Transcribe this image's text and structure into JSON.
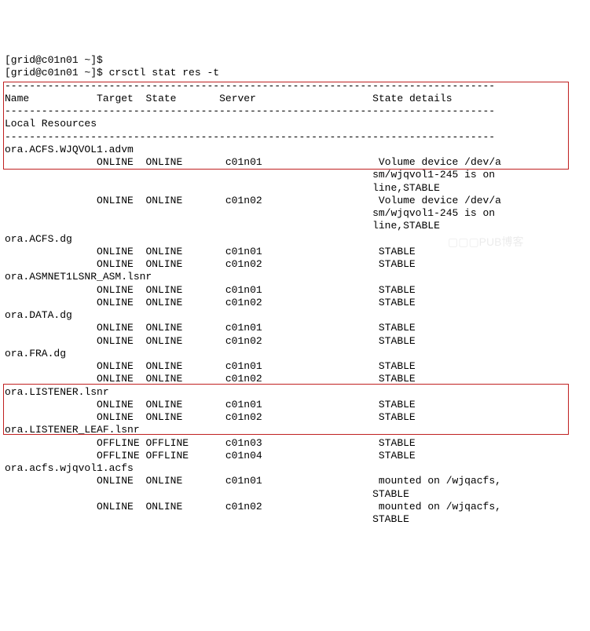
{
  "prompt1": "[grid@c01n01 ~]$",
  "prompt2": "[grid@c01n01 ~]$ crsctl stat res -t",
  "divider": "--------------------------------------------------------------------------------",
  "hdr_name": "Name",
  "hdr_target": "Target",
  "hdr_state": "State",
  "hdr_server": "Server",
  "hdr_details": "State details",
  "section_local": "Local Resources",
  "res": {
    "advm": "ora.ACFS.WJQVOL1.advm",
    "acfs_dg": "ora.ACFS.dg",
    "asmnet": "ora.ASMNET1LSNR_ASM.lsnr",
    "data_dg": "ora.DATA.dg",
    "fra_dg": "ora.FRA.dg",
    "listener": "ora.LISTENER.lsnr",
    "listener_leaf": "ora.LISTENER_LEAF.lsnr",
    "acfs_mount": "ora.acfs.wjqvol1.acfs"
  },
  "srv": {
    "n01": "c01n01",
    "n02": "c01n02",
    "n03": "c01n03",
    "n04": "c01n04"
  },
  "st": {
    "online": "ONLINE",
    "offline": "OFFLINE",
    "stable": "STABLE"
  },
  "det": {
    "vol1a": "Volume device /dev/a",
    "vol1b": "sm/wjqvol1-245 is on",
    "vol1c": "line,STABLE",
    "mnt1": "mounted on /wjqacfs,",
    "mnt1b": "STABLE",
    "mnt2": "mounted on /wjqacfs,",
    "mnt2b": "STABLE"
  },
  "watermark": "▢▢▢PUB博客"
}
